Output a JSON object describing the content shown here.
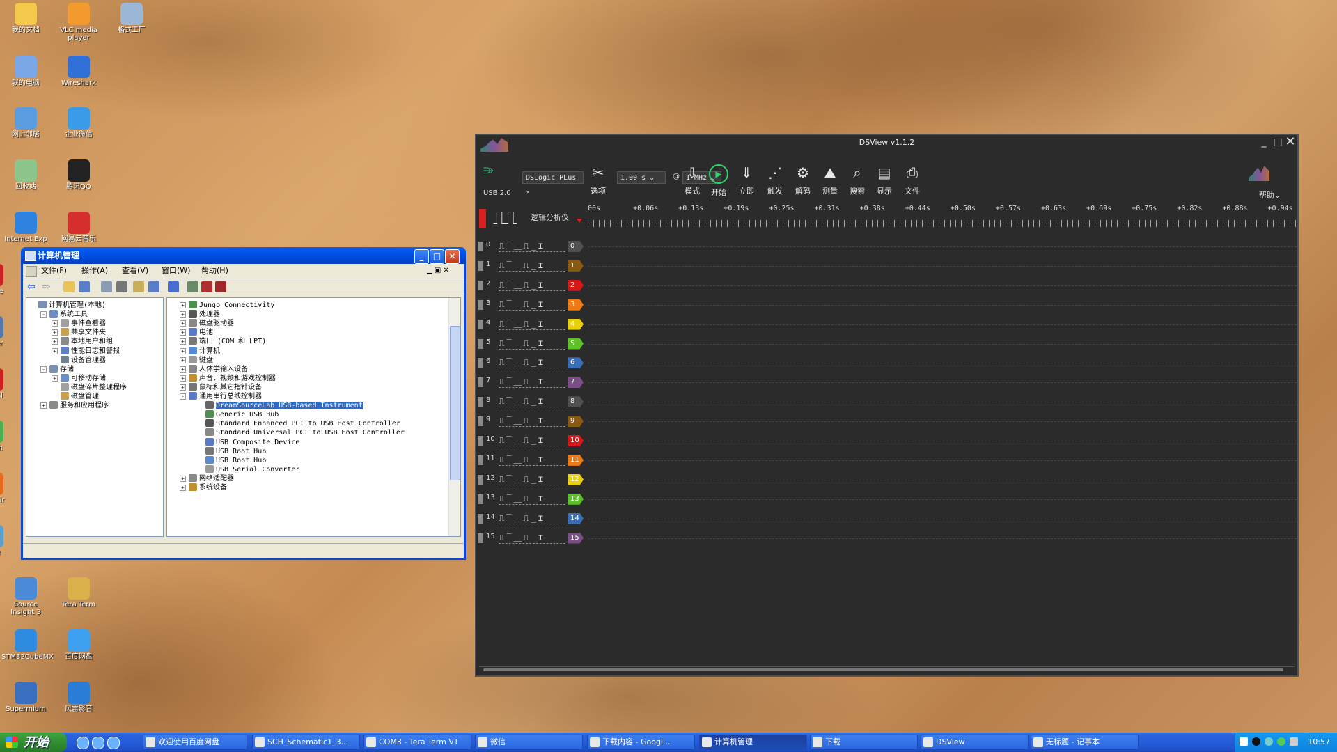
{
  "desktop_icons": [
    {
      "label": "我的文档",
      "color": "#f2c94c"
    },
    {
      "label": "VLC media player",
      "color": "#f29a2e"
    },
    {
      "label": "格式工厂",
      "color": "#9bb7d6"
    },
    {
      "label": "我的电脑",
      "color": "#7aa7e6"
    },
    {
      "label": "Wireshark",
      "color": "#2f6fd6"
    },
    {
      "label": "网上邻居",
      "color": "#5b9be0"
    },
    {
      "label": "企业微信",
      "color": "#3a9be8"
    },
    {
      "label": "回收站",
      "color": "#8cc68c"
    },
    {
      "label": "腾讯QQ",
      "color": "#222222"
    },
    {
      "label": "Internet Exp",
      "color": "#2f83e0"
    },
    {
      "label": "网易云音乐",
      "color": "#d62d2d"
    },
    {
      "label": "Adobe",
      "color": "#cc2222"
    },
    {
      "label": "Cy Ter",
      "color": "#5577aa"
    },
    {
      "label": "File Cl",
      "color": "#cc2222"
    },
    {
      "label": "Go Ch",
      "color": "#4caf50"
    },
    {
      "label": "Moz Fir",
      "color": "#e66b1f"
    },
    {
      "label": "Note",
      "color": "#5aa0d0"
    },
    {
      "label": "Source Insight 3",
      "color": "#4a8ad6"
    },
    {
      "label": "Tera Term",
      "color": "#d9b04a"
    },
    {
      "label": "STM32CubeMX",
      "color": "#2e8be0"
    },
    {
      "label": "百度网盘",
      "color": "#3da0f0"
    },
    {
      "label": "Supermium",
      "color": "#3a6fc0"
    },
    {
      "label": "风雷影音",
      "color": "#2a7dd6"
    }
  ],
  "taskbar": {
    "start_label": "开始",
    "tasks": [
      {
        "label": "欢迎使用百度网盘"
      },
      {
        "label": "SCH_Schematic1_3..."
      },
      {
        "label": "COM3 - Tera Term VT"
      },
      {
        "label": "微信"
      },
      {
        "label": "下载内容 - Googl..."
      },
      {
        "label": "计算机管理"
      },
      {
        "label": "下载"
      },
      {
        "label": "DSView"
      },
      {
        "label": "无标题 - 记事本"
      }
    ],
    "clock": "10:57"
  },
  "cm_window": {
    "title": "计算机管理",
    "menu": [
      "文件(F)",
      "操作(A)",
      "查看(V)",
      "窗口(W)",
      "帮助(H)"
    ],
    "left_tree": [
      {
        "label": "计算机管理(本地)",
        "indent": 0,
        "pm": ""
      },
      {
        "label": "系统工具",
        "indent": 1,
        "pm": "-"
      },
      {
        "label": "事件查看器",
        "indent": 2,
        "pm": "+"
      },
      {
        "label": "共享文件夹",
        "indent": 2,
        "pm": "+"
      },
      {
        "label": "本地用户和组",
        "indent": 2,
        "pm": "+"
      },
      {
        "label": "性能日志和警报",
        "indent": 2,
        "pm": "+"
      },
      {
        "label": "设备管理器",
        "indent": 2,
        "pm": ""
      },
      {
        "label": "存储",
        "indent": 1,
        "pm": "-"
      },
      {
        "label": "可移动存储",
        "indent": 2,
        "pm": "+"
      },
      {
        "label": "磁盘碎片整理程序",
        "indent": 2,
        "pm": ""
      },
      {
        "label": "磁盘管理",
        "indent": 2,
        "pm": ""
      },
      {
        "label": "服务和应用程序",
        "indent": 1,
        "pm": "+"
      }
    ],
    "right_tree": [
      {
        "label": "Jungo Connectivity",
        "indent": 0,
        "pm": "+"
      },
      {
        "label": "处理器",
        "indent": 0,
        "pm": "+"
      },
      {
        "label": "磁盘驱动器",
        "indent": 0,
        "pm": "+"
      },
      {
        "label": "电池",
        "indent": 0,
        "pm": "+"
      },
      {
        "label": "端口 (COM 和 LPT)",
        "indent": 0,
        "pm": "+"
      },
      {
        "label": "计算机",
        "indent": 0,
        "pm": "+"
      },
      {
        "label": "键盘",
        "indent": 0,
        "pm": "+"
      },
      {
        "label": "人体学输入设备",
        "indent": 0,
        "pm": "+"
      },
      {
        "label": "声音、视频和游戏控制器",
        "indent": 0,
        "pm": "+"
      },
      {
        "label": "鼠标和其它指针设备",
        "indent": 0,
        "pm": "+"
      },
      {
        "label": "通用串行总线控制器",
        "indent": 0,
        "pm": "-"
      },
      {
        "label": "DreamSourceLab USB-based Instrument",
        "indent": 1,
        "pm": "",
        "selected": true
      },
      {
        "label": "Generic USB Hub",
        "indent": 1,
        "pm": ""
      },
      {
        "label": "Standard Enhanced PCI to USB Host Controller",
        "indent": 1,
        "pm": ""
      },
      {
        "label": "Standard Universal PCI to USB Host Controller",
        "indent": 1,
        "pm": ""
      },
      {
        "label": "USB Composite Device",
        "indent": 1,
        "pm": ""
      },
      {
        "label": "USB Root Hub",
        "indent": 1,
        "pm": ""
      },
      {
        "label": "USB Root Hub",
        "indent": 1,
        "pm": ""
      },
      {
        "label": "USB Serial Converter",
        "indent": 1,
        "pm": ""
      },
      {
        "label": "网络适配器",
        "indent": 0,
        "pm": "+"
      },
      {
        "label": "系统设备",
        "indent": 0,
        "pm": "+"
      }
    ]
  },
  "dsview": {
    "title": "DSView v1.1.2",
    "usb_label": "USB 2.0",
    "device": "DSLogic PLus",
    "duration": "1.00 s",
    "at": "@",
    "rate": "1 MHz",
    "tools": [
      {
        "label": "选项",
        "icon": "wrench-icon"
      },
      {
        "label": "模式",
        "icon": "download-icon"
      },
      {
        "label": "开始",
        "icon": "play-icon"
      },
      {
        "label": "立即",
        "icon": "instant-icon"
      },
      {
        "label": "触发",
        "icon": "trigger-icon"
      },
      {
        "label": "解码",
        "icon": "decode-icon"
      },
      {
        "label": "测量",
        "icon": "measure-icon"
      },
      {
        "label": "搜索",
        "icon": "search-icon"
      },
      {
        "label": "显示",
        "icon": "display-icon"
      },
      {
        "label": "文件",
        "icon": "file-icon"
      }
    ],
    "help_label": "帮助",
    "mode_label": "逻辑分析仪",
    "ticks": [
      "00s",
      "+0.06s",
      "+0.13s",
      "+0.19s",
      "+0.25s",
      "+0.31s",
      "+0.38s",
      "+0.44s",
      "+0.50s",
      "+0.57s",
      "+0.63s",
      "+0.69s",
      "+0.75s",
      "+0.82s",
      "+0.88s",
      "+0.94s"
    ],
    "trigger_wave": "⎍‾⎽⎍_⌶",
    "channels": [
      {
        "num": "0",
        "color": "#505050"
      },
      {
        "num": "1",
        "color": "#8a5a12"
      },
      {
        "num": "2",
        "color": "#d81818"
      },
      {
        "num": "3",
        "color": "#f07a12"
      },
      {
        "num": "4",
        "color": "#e8d10a"
      },
      {
        "num": "5",
        "color": "#5cc228"
      },
      {
        "num": "6",
        "color": "#3a6fb8"
      },
      {
        "num": "7",
        "color": "#7a4f86"
      },
      {
        "num": "8",
        "color": "#505050"
      },
      {
        "num": "9",
        "color": "#8a5a12"
      },
      {
        "num": "10",
        "color": "#d81818"
      },
      {
        "num": "11",
        "color": "#f07a12"
      },
      {
        "num": "12",
        "color": "#e8d10a"
      },
      {
        "num": "13",
        "color": "#5cc228"
      },
      {
        "num": "14",
        "color": "#3a6fb8"
      },
      {
        "num": "15",
        "color": "#7a4f86"
      }
    ]
  }
}
